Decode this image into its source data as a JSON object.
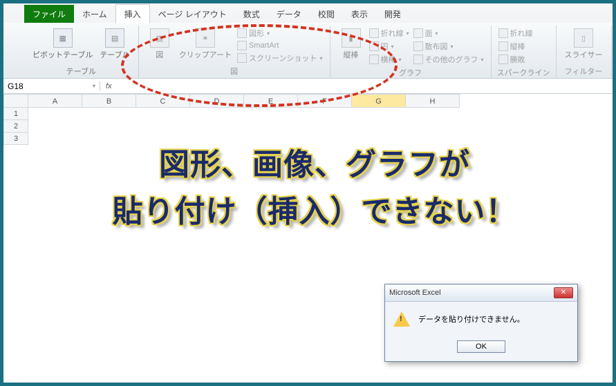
{
  "tabs": {
    "file": "ファイル",
    "home": "ホーム",
    "insert": "挿入",
    "layout": "ページ レイアウト",
    "formula": "数式",
    "data": "データ",
    "review": "校閲",
    "view": "表示",
    "dev": "開発"
  },
  "groups": {
    "tables": {
      "pivot": "ピボットテーブル",
      "table": "テーブル",
      "label": "テーブル"
    },
    "illus": {
      "pic": "図",
      "clip": "クリップアート",
      "shapes": "図形",
      "smartart": "SmartArt",
      "screenshot": "スクリーンショット",
      "label": "図"
    },
    "charts": {
      "column": "縦棒",
      "line": "折れ線",
      "pie": "円",
      "bar": "横棒",
      "area": "面",
      "scatter": "散布図",
      "other": "その他のグラフ",
      "label": "グラフ"
    },
    "spark": {
      "line": "折れ線",
      "column": "縦棒",
      "winloss": "勝敗",
      "label": "スパークライン"
    },
    "filter": {
      "slicer": "スライサー",
      "label": "フィルター"
    }
  },
  "namebox": "G18",
  "columns": [
    "A",
    "B",
    "C",
    "D",
    "E",
    "F",
    "G",
    "H"
  ],
  "rows": [
    "1",
    "2",
    "3"
  ],
  "caption_l1": "図形、画像、グラフが",
  "caption_l2": "貼り付け（挿入）できない！",
  "dialog": {
    "title": "Microsoft Excel",
    "msg": "データを貼り付けできません。",
    "ok": "OK"
  }
}
